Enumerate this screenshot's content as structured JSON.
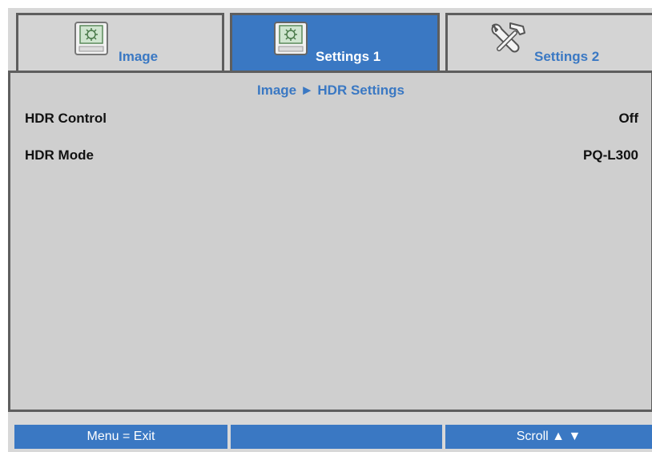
{
  "tabs": [
    {
      "label": "Image",
      "icon": "image-icon",
      "active": false
    },
    {
      "label": "Settings 1",
      "icon": "settings-icon",
      "active": true
    },
    {
      "label": "Settings 2",
      "icon": "tools-icon",
      "active": false
    }
  ],
  "breadcrumb": "Image ► HDR Settings",
  "rows": [
    {
      "label": "HDR Control",
      "value": "Off"
    },
    {
      "label": "HDR Mode",
      "value": "PQ-L300"
    }
  ],
  "status": {
    "left": "Menu = Exit",
    "middle": "",
    "right": "Scroll ▲ ▼"
  },
  "colors": {
    "accent": "#3a78c3",
    "frame": "#5e5e5e",
    "background": "#d8d8d8"
  }
}
